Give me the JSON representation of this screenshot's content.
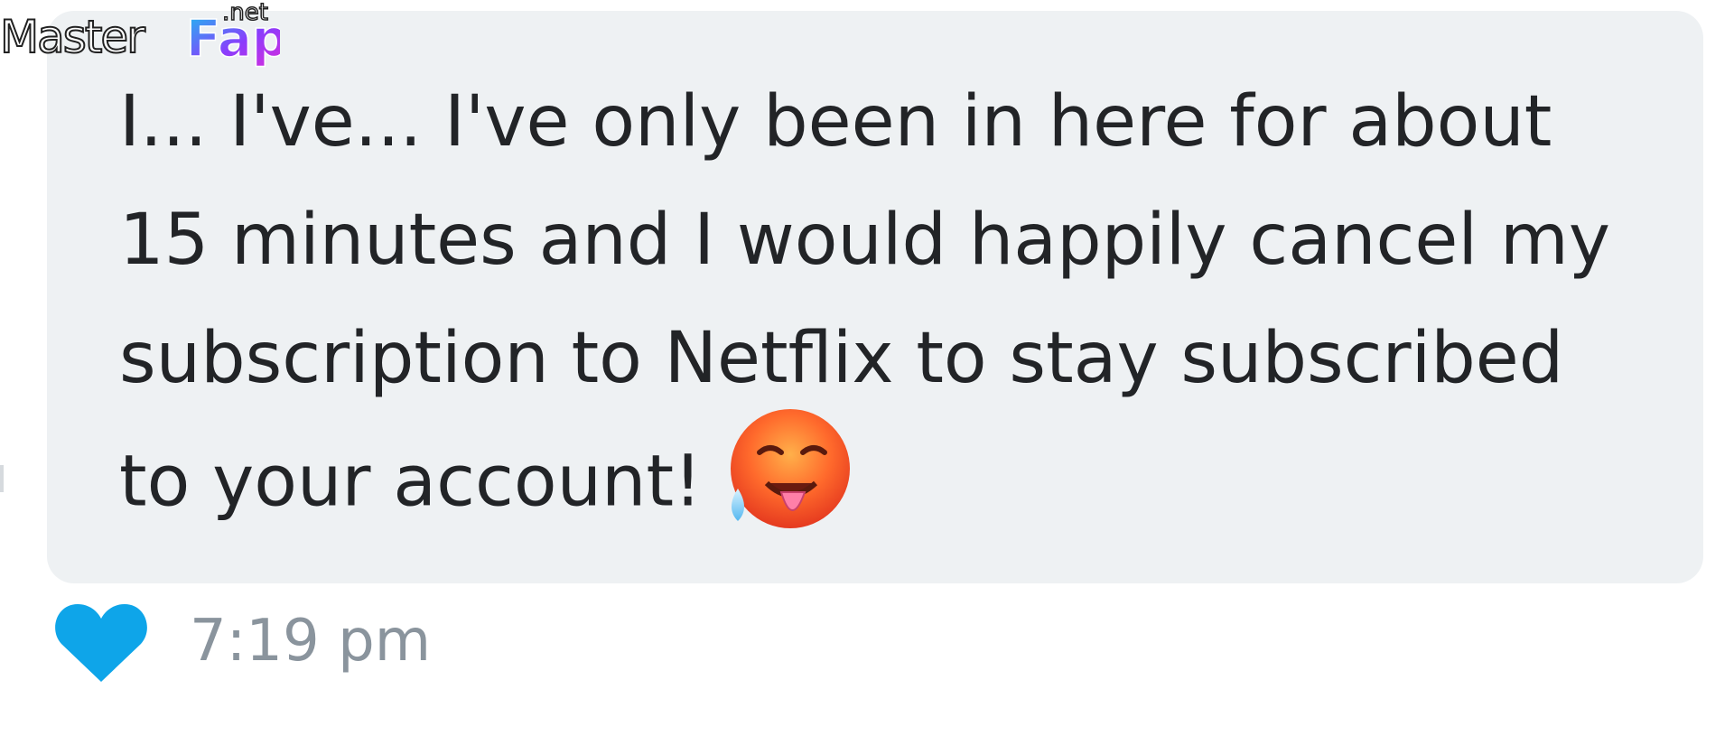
{
  "watermark": {
    "brand_prefix": "Master",
    "brand_suffix": "Fap",
    "tld": ".net"
  },
  "message": {
    "text": "I... I've... I've only been in here for about 15 minutes and I would happily cancel my subscription to Netflix to stay subscribed to your account!",
    "emoji_icon": "hot-face-emoji-icon"
  },
  "footer": {
    "like_icon": "heart-icon",
    "timestamp": "7:19 pm"
  },
  "colors": {
    "bubble_background": "#eef1f3",
    "message_text": "#222427",
    "heart": "#0ea5e9",
    "timestamp_text": "#8a949d"
  }
}
